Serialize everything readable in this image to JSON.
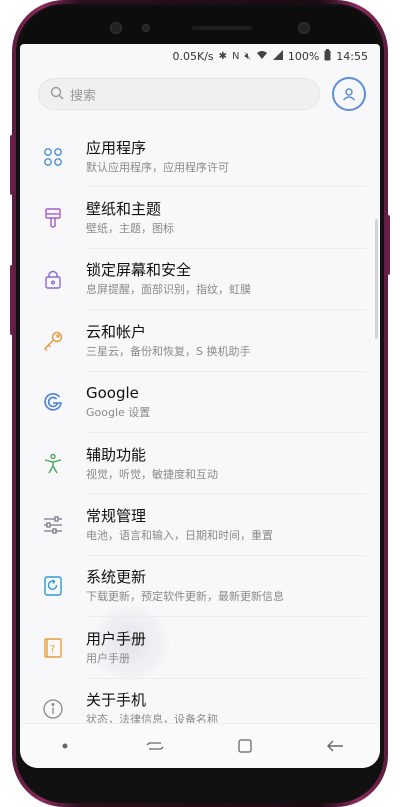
{
  "status": {
    "speed": "0.05K/s",
    "battery": "100%",
    "time": "14:55"
  },
  "search": {
    "placeholder": "搜索"
  },
  "items": [
    {
      "title": "应用程序",
      "subtitle": "默认应用程序，应用程序许可",
      "icon": "apps-icon",
      "color": "#4a90d9"
    },
    {
      "title": "壁纸和主题",
      "subtitle": "壁纸，主题，图标",
      "icon": "paintbrush-icon",
      "color": "#a65cc9"
    },
    {
      "title": "锁定屏幕和安全",
      "subtitle": "息屏提醒，面部识别，指纹，虹膜",
      "icon": "lock-icon",
      "color": "#8b6bd1"
    },
    {
      "title": "云和帐户",
      "subtitle": "三星云，备份和恢复，S 换机助手",
      "icon": "key-icon",
      "color": "#e69a3c"
    },
    {
      "title": "Google",
      "subtitle": "Google 设置",
      "icon": "google-icon",
      "color": "#4a7fd4"
    },
    {
      "title": "辅助功能",
      "subtitle": "视觉，听觉，敏捷度和互动",
      "icon": "accessibility-icon",
      "color": "#46a65a"
    },
    {
      "title": "常规管理",
      "subtitle": "电池，语言和输入，日期和时间，重置",
      "icon": "sliders-icon",
      "color": "#7a7a8a"
    },
    {
      "title": "系统更新",
      "subtitle": "下载更新，预定软件更新，最新更新信息",
      "icon": "update-icon",
      "color": "#2e9bd1"
    },
    {
      "title": "用户手册",
      "subtitle": "用户手册",
      "icon": "manual-icon",
      "color": "#e6a03c"
    },
    {
      "title": "关于手机",
      "subtitle": "状态，法律信息，设备名称",
      "icon": "info-icon",
      "color": "#8a8a8a"
    }
  ]
}
